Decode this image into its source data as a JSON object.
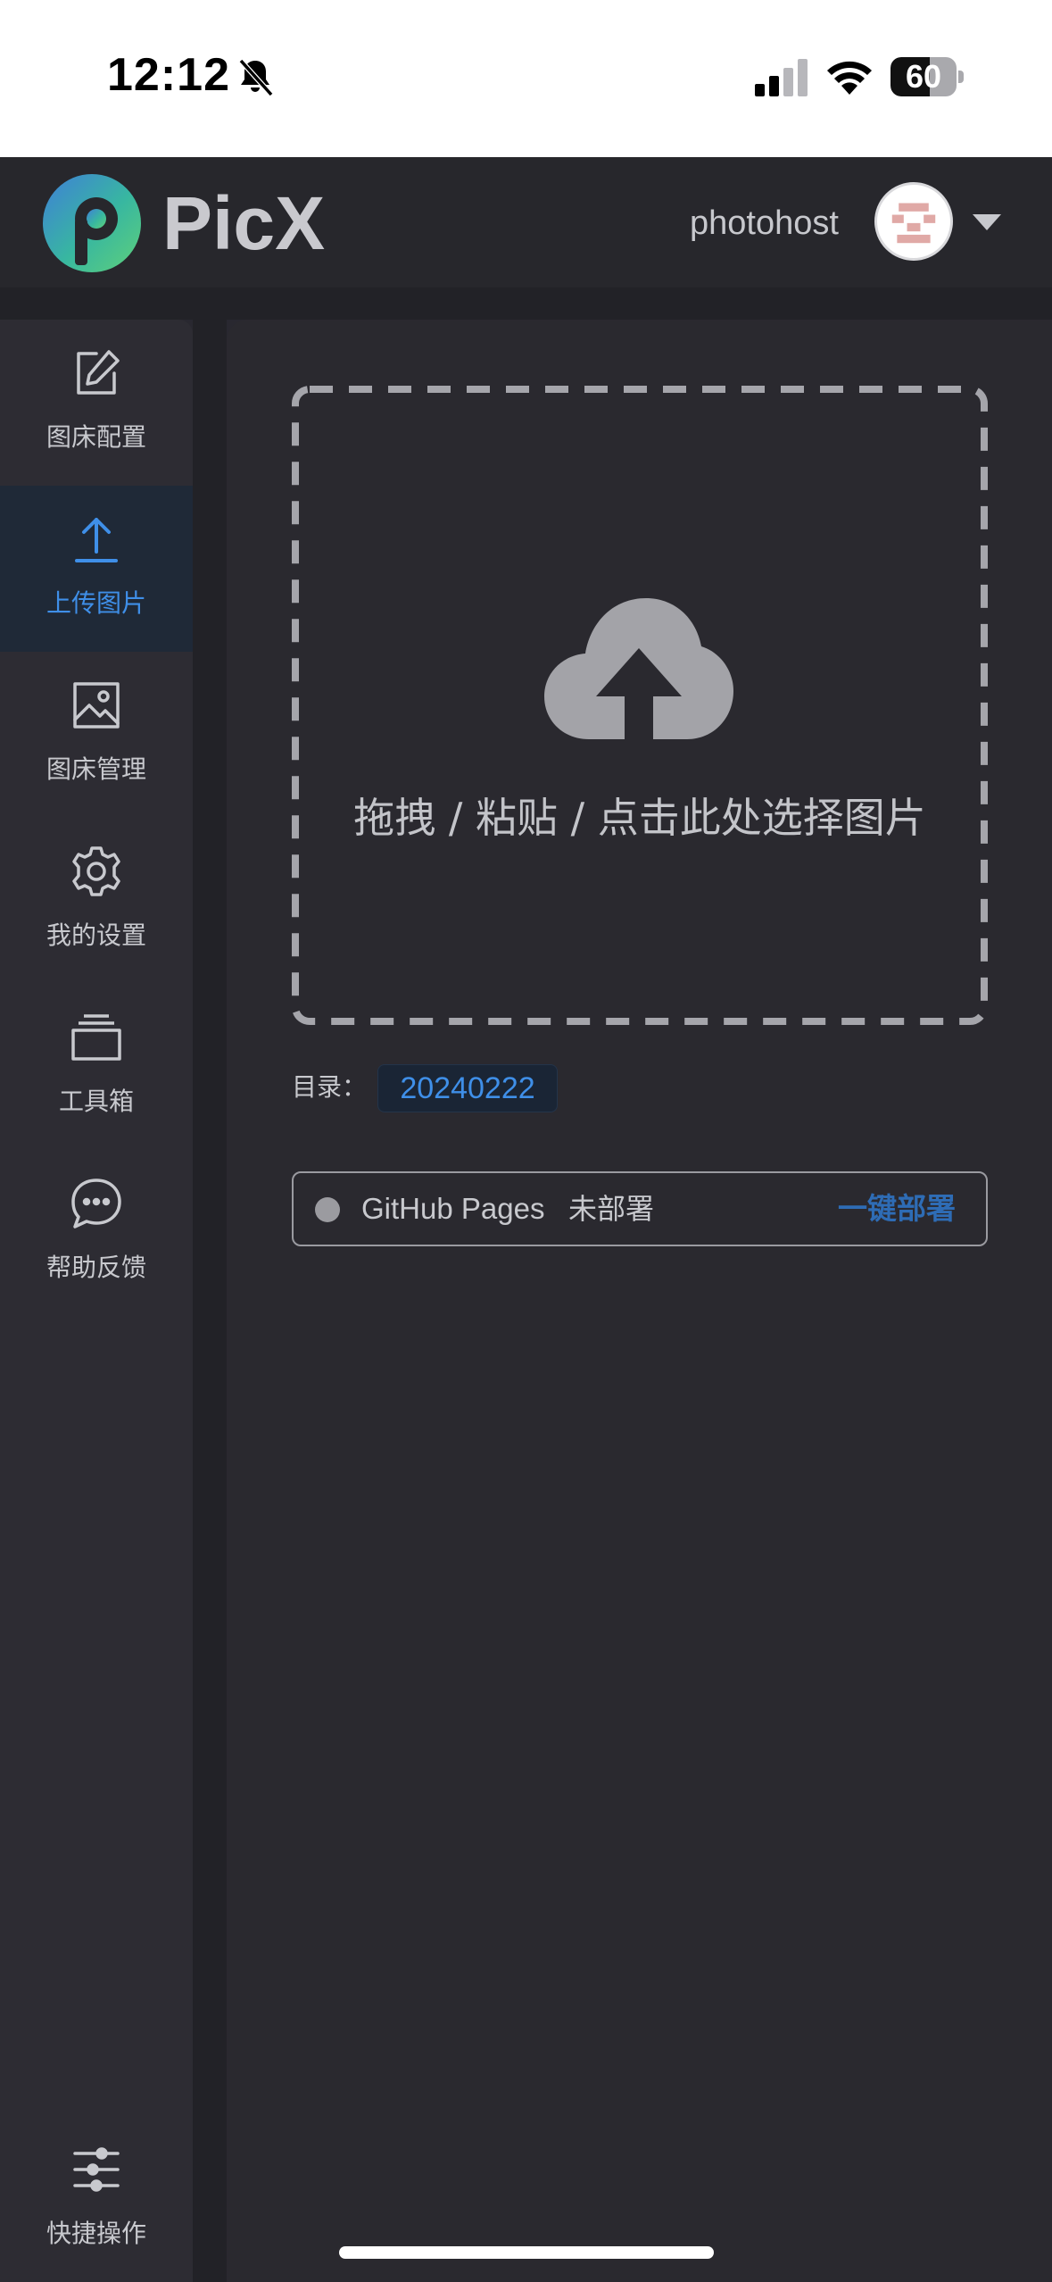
{
  "status_bar": {
    "time": "12:12",
    "battery": "60",
    "battery_level": 0.6
  },
  "header": {
    "brand": "PicX",
    "username": "photohost"
  },
  "sidebar": {
    "items": [
      {
        "label": "图床配置",
        "icon": "edit-icon",
        "active": false
      },
      {
        "label": "上传图片",
        "icon": "upload-icon",
        "active": true
      },
      {
        "label": "图床管理",
        "icon": "image-icon",
        "active": false
      },
      {
        "label": "我的设置",
        "icon": "gear-icon",
        "active": false
      },
      {
        "label": "工具箱",
        "icon": "toolbox-icon",
        "active": false
      },
      {
        "label": "帮助反馈",
        "icon": "chat-icon",
        "active": false
      }
    ],
    "bottom_item": {
      "label": "快捷操作",
      "icon": "sliders-icon"
    }
  },
  "upload": {
    "prompt": "拖拽 / 粘贴 / 点击此处选择图片"
  },
  "directory": {
    "label": "目录：",
    "value": "20240222"
  },
  "deploy": {
    "service": "GitHub Pages",
    "status": "未部署",
    "action": "一键部署"
  },
  "colors": {
    "accent": "#3f8fe8",
    "background": "#292830",
    "sidebar": "#2d2c33"
  }
}
